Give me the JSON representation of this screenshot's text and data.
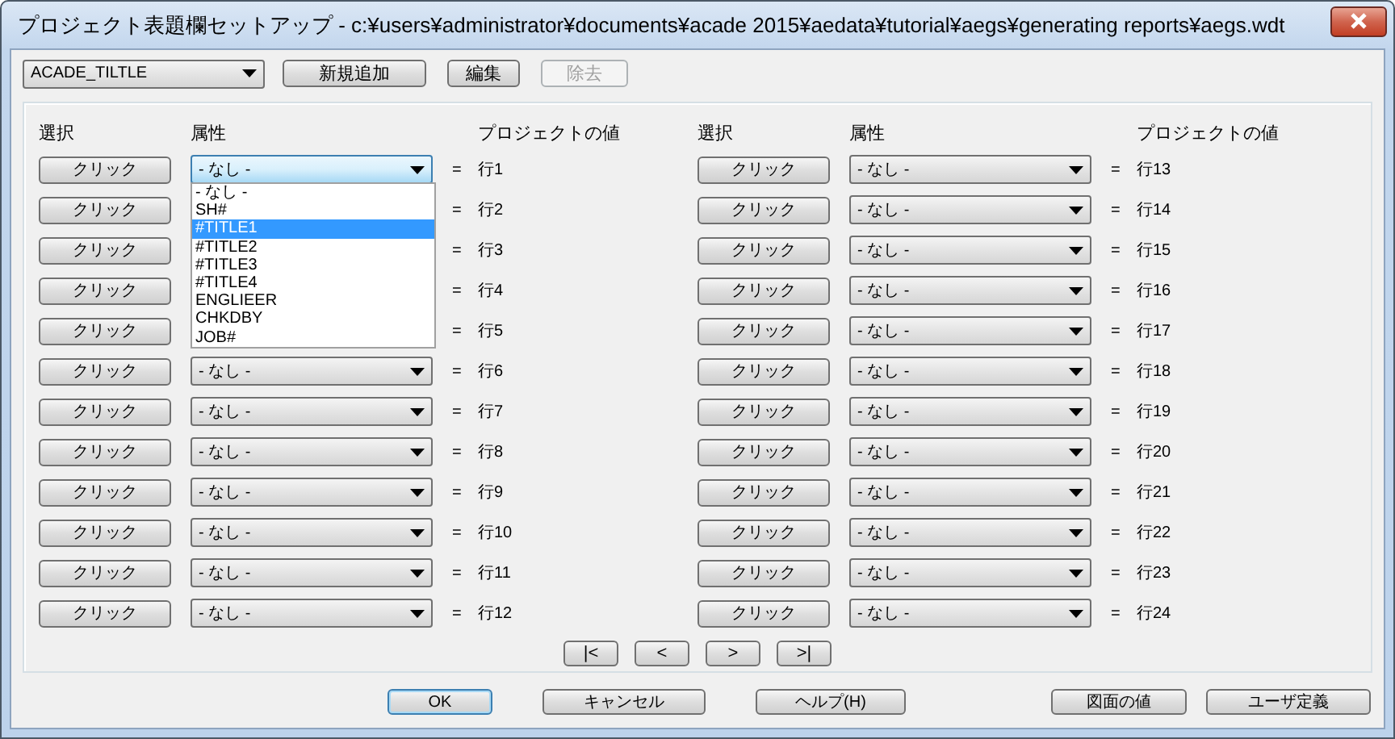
{
  "window": {
    "title": "プロジェクト表題欄セットアップ - c:¥users¥administrator¥documents¥acade 2015¥aedata¥tutorial¥aegs¥generating reports¥aegs.wdt"
  },
  "toolbar": {
    "title_block": "ACADE_TILTLE",
    "buttons": [
      {
        "label": "新規追加",
        "disabled": false
      },
      {
        "label": "編集",
        "disabled": false
      },
      {
        "label": "除去",
        "disabled": true
      }
    ]
  },
  "groups": [
    {
      "headers": [
        "選択",
        "属性",
        "プロジェクトの値"
      ],
      "rows": [
        {
          "button": "クリック",
          "attribute": "- なし -",
          "equals": "=",
          "value": "行1",
          "expanded": true,
          "options": [
            {
              "label": "- なし -",
              "selected": false
            },
            {
              "label": "SH#",
              "selected": false
            },
            {
              "label": "#TITLE1",
              "selected": true
            },
            {
              "label": "#TITLE2",
              "selected": false
            },
            {
              "label": "#TITLE3",
              "selected": false
            },
            {
              "label": "#TITLE4",
              "selected": false
            },
            {
              "label": "ENGLIEER",
              "selected": false
            },
            {
              "label": "CHKDBY",
              "selected": false
            },
            {
              "label": "JOB#",
              "selected": false
            }
          ]
        },
        {
          "button": "クリック",
          "equals": "=",
          "value": "行2",
          "expanded": false
        },
        {
          "button": "クリック",
          "equals": "=",
          "value": "行3",
          "expanded": false
        },
        {
          "button": "クリック",
          "equals": "=",
          "value": "行4",
          "expanded": false
        },
        {
          "button": "クリック",
          "equals": "=",
          "value": "行5",
          "expanded": false
        },
        {
          "button": "クリック",
          "attribute": "- なし -",
          "equals": "=",
          "value": "行6",
          "expanded": false
        },
        {
          "button": "クリック",
          "attribute": "- なし -",
          "equals": "=",
          "value": "行7",
          "expanded": false
        },
        {
          "button": "クリック",
          "attribute": "- なし -",
          "equals": "=",
          "value": "行8",
          "expanded": false
        },
        {
          "button": "クリック",
          "attribute": "- なし -",
          "equals": "=",
          "value": "行9",
          "expanded": false
        },
        {
          "button": "クリック",
          "attribute": "- なし -",
          "equals": "=",
          "value": "行10",
          "expanded": false
        },
        {
          "button": "クリック",
          "attribute": "- なし -",
          "equals": "=",
          "value": "行11",
          "expanded": false
        },
        {
          "button": "クリック",
          "attribute": "- なし -",
          "equals": "=",
          "value": "行12",
          "expanded": false
        }
      ]
    },
    {
      "headers": [
        "選択",
        "属性",
        "プロジェクトの値"
      ],
      "rows": [
        {
          "button": "クリック",
          "attribute": "- なし -",
          "equals": "=",
          "value": "行13",
          "expanded": false
        },
        {
          "button": "クリック",
          "attribute": "- なし -",
          "equals": "=",
          "value": "行14",
          "expanded": false
        },
        {
          "button": "クリック",
          "attribute": "- なし -",
          "equals": "=",
          "value": "行15",
          "expanded": false
        },
        {
          "button": "クリック",
          "attribute": "- なし -",
          "equals": "=",
          "value": "行16",
          "expanded": false
        },
        {
          "button": "クリック",
          "attribute": "- なし -",
          "equals": "=",
          "value": "行17",
          "expanded": false
        },
        {
          "button": "クリック",
          "attribute": "- なし -",
          "equals": "=",
          "value": "行18",
          "expanded": false
        },
        {
          "button": "クリック",
          "attribute": "- なし -",
          "equals": "=",
          "value": "行19",
          "expanded": false
        },
        {
          "button": "クリック",
          "attribute": "- なし -",
          "equals": "=",
          "value": "行20",
          "expanded": false
        },
        {
          "button": "クリック",
          "attribute": "- なし -",
          "equals": "=",
          "value": "行21",
          "expanded": false
        },
        {
          "button": "クリック",
          "attribute": "- なし -",
          "equals": "=",
          "value": "行22",
          "expanded": false
        },
        {
          "button": "クリック",
          "attribute": "- なし -",
          "equals": "=",
          "value": "行23",
          "expanded": false
        },
        {
          "button": "クリック",
          "attribute": "- なし -",
          "equals": "=",
          "value": "行24",
          "expanded": false
        }
      ]
    }
  ],
  "pager": [
    "|<",
    "<",
    ">",
    ">|"
  ],
  "dialog_buttons": [
    {
      "label": "OK",
      "default": true
    },
    {
      "label": "キャンセル",
      "default": false
    },
    {
      "label": "ヘルプ(H)",
      "default": false
    }
  ],
  "value_buttons": [
    {
      "label": "図面の値",
      "default": false
    },
    {
      "label": "ユーザ定義",
      "default": false
    }
  ]
}
